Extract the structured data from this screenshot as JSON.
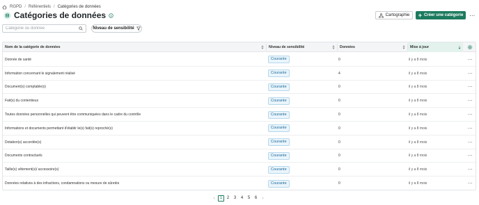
{
  "breadcrumb": {
    "home": "RGPD",
    "level2": "Référentiels",
    "current": "Catégories de données"
  },
  "page": {
    "title": "Catégories de données"
  },
  "header_actions": {
    "cartography_label": "Cartographie",
    "create_label": "Créer une catégorie",
    "more_label": "⋯"
  },
  "filters": {
    "search_placeholder": "Catégorie ou donnée",
    "sensitivity_label": "Niveau de sensibilité"
  },
  "table": {
    "columns": {
      "name": "Nom de la catégorie de données",
      "level": "Niveau de sensibilité",
      "count": "Données",
      "updated": "Mise à jour"
    },
    "rows": [
      {
        "name": "Donnée de santé",
        "level": "Courante",
        "count": "0",
        "updated": "il y a 8 mois"
      },
      {
        "name": "Information concernant le signalement réalisé",
        "level": "Courante",
        "count": "4",
        "updated": "il y a 8 mois"
      },
      {
        "name": "Document(s) comptable(s)",
        "level": "Courante",
        "count": "0",
        "updated": "il y a 8 mois"
      },
      {
        "name": "Fait(s) du contentieux",
        "level": "Courante",
        "count": "0",
        "updated": "il y a 8 mois"
      },
      {
        "name": "Toutes données personnelles qui peuvent être communiquées dans le cadre du contrôle",
        "level": "Courante",
        "count": "0",
        "updated": "il y a 8 mois"
      },
      {
        "name": "Informations et documents permettant d'établir le(s) fait(s) reproché(s)",
        "level": "Courante",
        "count": "0",
        "updated": "il y a 8 mois"
      },
      {
        "name": "Dotation(s) accordée(s)",
        "level": "Courante",
        "count": "0",
        "updated": "il y a 8 mois"
      },
      {
        "name": "Documents contractuels",
        "level": "Courante",
        "count": "0",
        "updated": "il y a 8 mois"
      },
      {
        "name": "Taille(s) vêtement(s)/ accessoire(s)",
        "level": "Courante",
        "count": "0",
        "updated": "il y a 8 mois"
      },
      {
        "name": "Données relatives à des infractions, condamnations ou mesure de sûretés",
        "level": "Courante",
        "count": "0",
        "updated": "il y a 8 mois"
      }
    ]
  },
  "pagination": {
    "prev": "‹",
    "next": "›",
    "pages": [
      "1",
      "2",
      "3",
      "4",
      "5",
      "6"
    ],
    "current": "1"
  },
  "colors": {
    "primary": "#1d7a5e",
    "badge_text": "#1e6a9a",
    "badge_bg": "#eaf5fc"
  },
  "icons": {
    "home": "home-icon",
    "title": "database-icon",
    "info": "info-icon",
    "cartography": "network-icon",
    "create": "plus-icon",
    "search": "search-icon",
    "filter": "funnel-icon",
    "settings": "gear-icon",
    "row_more": "ellipsis-icon"
  }
}
